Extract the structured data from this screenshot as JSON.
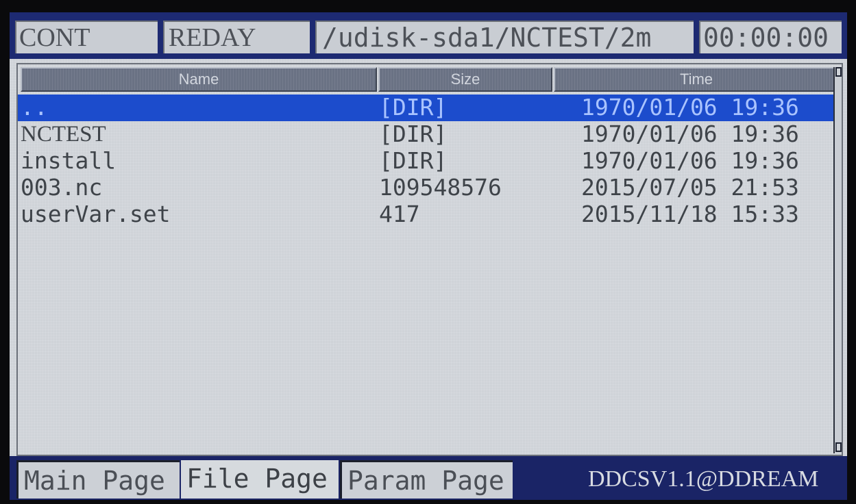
{
  "status": {
    "mode": "CONT",
    "state": "REDAY",
    "path": "/udisk-sda1/NCTEST/2m",
    "timer": "00:00:00"
  },
  "file_list": {
    "columns": {
      "name": "Name",
      "size": "Size",
      "time": "Time"
    },
    "rows": [
      {
        "name": "..",
        "size": "[DIR]",
        "time": "1970/01/06 19:36",
        "selected": true
      },
      {
        "name": "NCTEST",
        "size": "[DIR]",
        "time": "1970/01/06 19:36"
      },
      {
        "name": "install",
        "size": "[DIR]",
        "time": "1970/01/06 19:36"
      },
      {
        "name": "003.nc",
        "size": "109548576",
        "time": "2015/07/05 21:53"
      },
      {
        "name": "userVar.set",
        "size": "417",
        "time": "2015/11/18 15:33"
      }
    ]
  },
  "tabs": {
    "main": "Main Page",
    "file": "File Page",
    "param": "Param Page"
  },
  "brand": "DDCSV1.1@DDREAM",
  "colors": {
    "bar_background": "#1d2a72",
    "selection": "#1c4ccc",
    "screen": "#cfd3d8"
  }
}
